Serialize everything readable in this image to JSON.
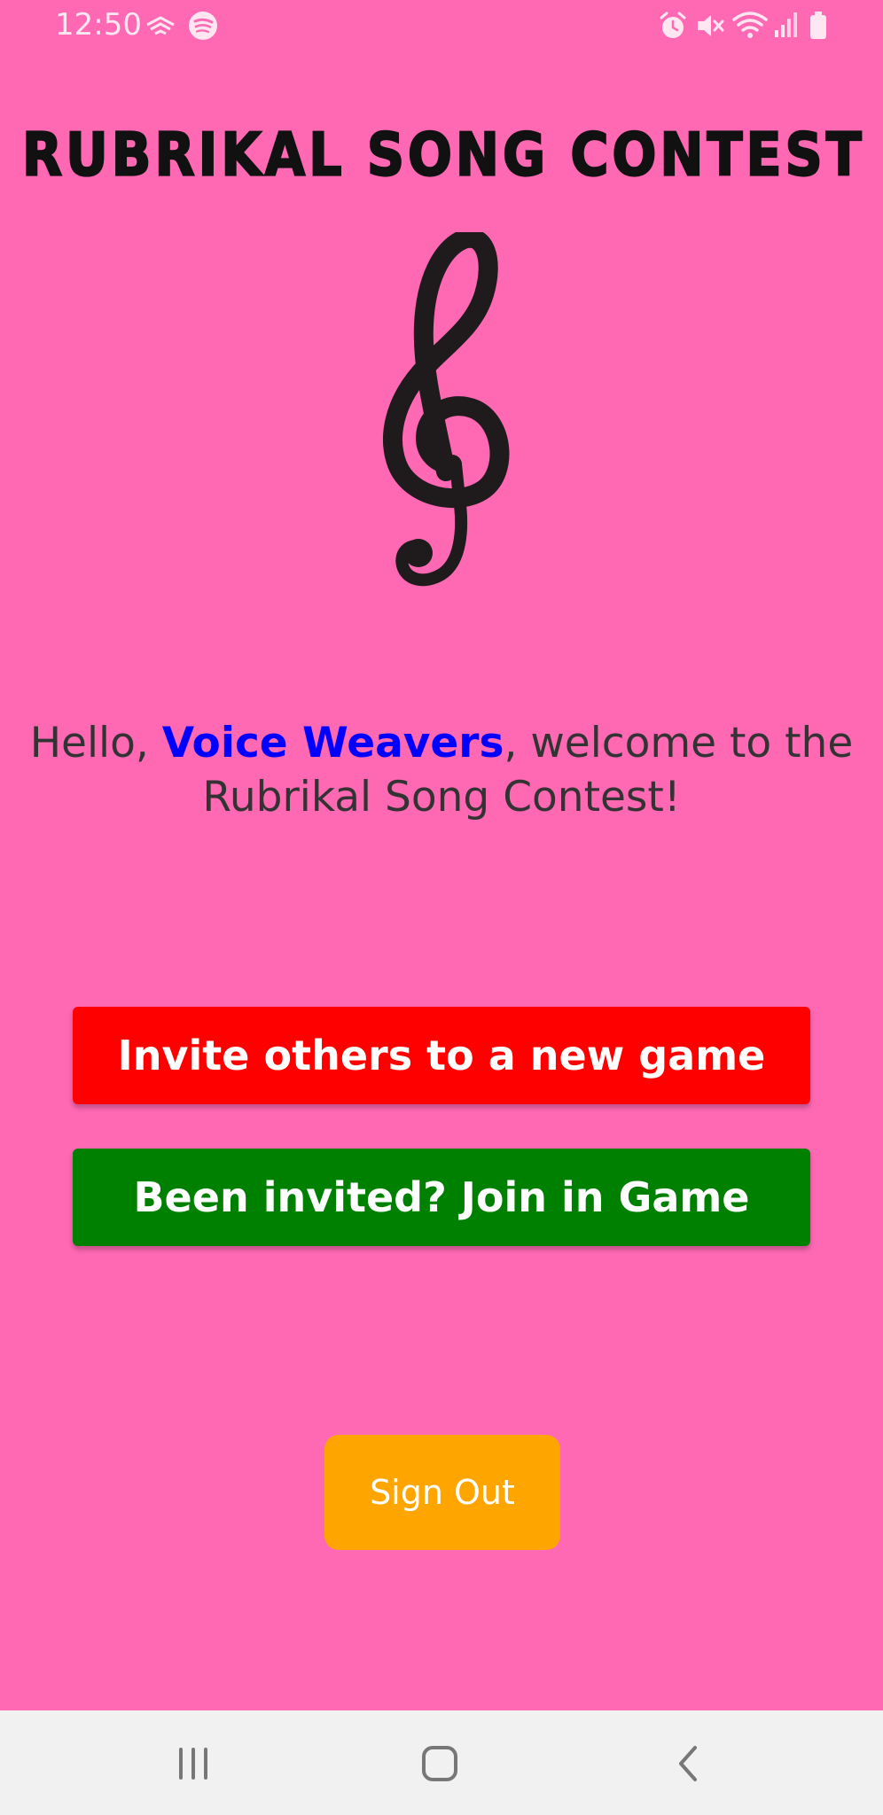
{
  "status_bar": {
    "time": "12:50",
    "left_icons": [
      "cast-wireless-icon",
      "spotify-icon"
    ],
    "right_icons": [
      "alarm-icon",
      "mute-icon",
      "wifi-icon",
      "signal-icon",
      "battery-icon"
    ]
  },
  "app": {
    "title": "RUBRIKAL SONG CONTEST",
    "logo_icon": "treble-clef-icon"
  },
  "welcome": {
    "greeting_prefix": "Hello, ",
    "team_name": "Voice Weavers",
    "greeting_suffix": ", welcome to the Rubrikal Song Contest!"
  },
  "buttons": {
    "invite_label": "Invite others to a new game",
    "join_label": "Been invited? Join in Game",
    "signout_label": "Sign Out"
  },
  "colors": {
    "background": "#ff69b4",
    "invite_button": "#ff0000",
    "join_button": "#008000",
    "signout_button": "#ffa500",
    "team_name": "#0000ff"
  },
  "nav_bar": {
    "icons": [
      "recent-apps-icon",
      "home-icon",
      "back-icon"
    ]
  }
}
